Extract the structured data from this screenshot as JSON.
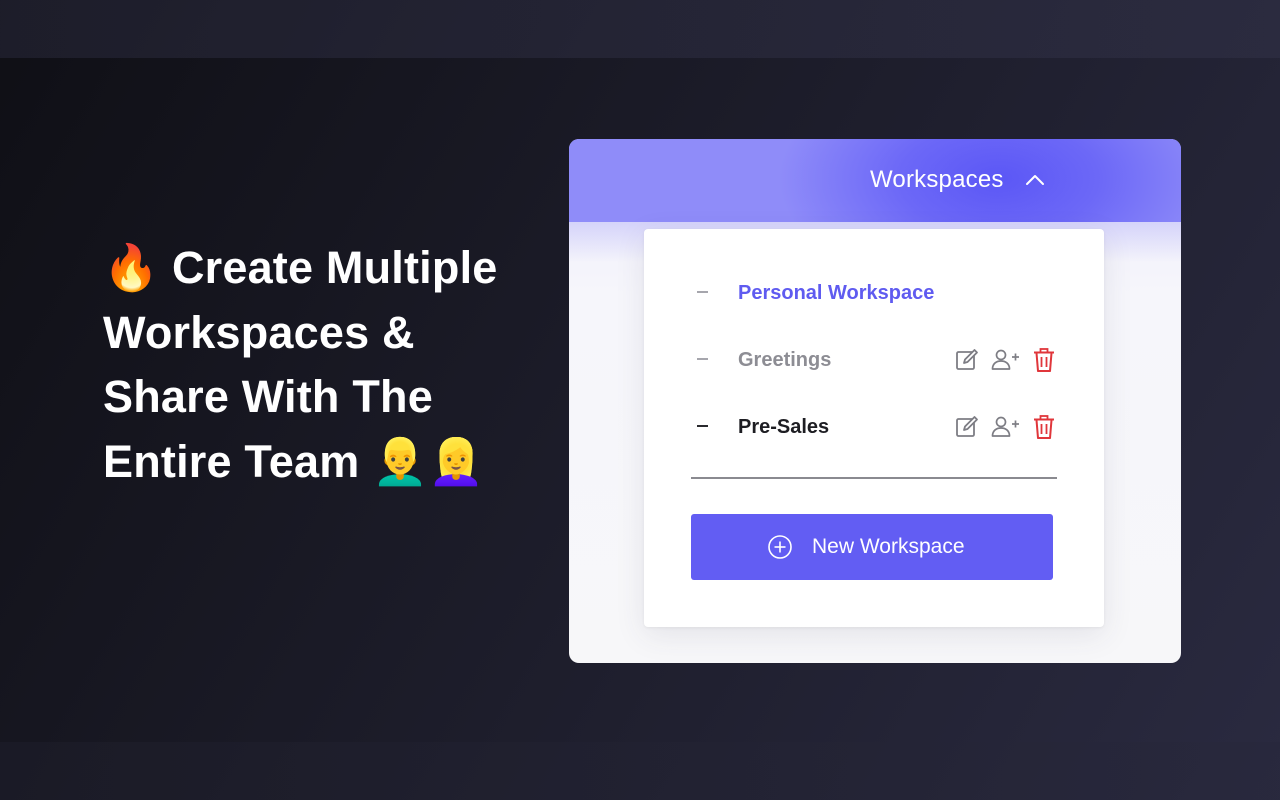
{
  "headline": {
    "lines": [
      {
        "emoji": "🔥",
        "text": "Create Multiple"
      },
      {
        "text": "Workspaces &"
      },
      {
        "text": "Share With The"
      },
      {
        "text": "Entire Team",
        "emoji": "👱‍♂️👱‍♀️"
      }
    ]
  },
  "card": {
    "header": {
      "title": "Workspaces",
      "icon": "chevron-up-icon"
    },
    "workspaces": [
      {
        "label": "Personal Workspace",
        "state": "active",
        "actions": []
      },
      {
        "label": "Greetings",
        "state": "muted",
        "actions": [
          "edit-icon",
          "add-user-icon",
          "trash-icon"
        ]
      },
      {
        "label": "Pre-Sales",
        "state": "normal",
        "actions": [
          "edit-icon",
          "add-user-icon",
          "trash-icon"
        ]
      }
    ],
    "new_button": {
      "label": "New Workspace",
      "icon": "plus-circle-icon"
    }
  },
  "colors": {
    "accent": "#625df3",
    "active_text": "#5f5bf0",
    "delete": "#e0363b",
    "icon_gray": "#7d7d84"
  }
}
